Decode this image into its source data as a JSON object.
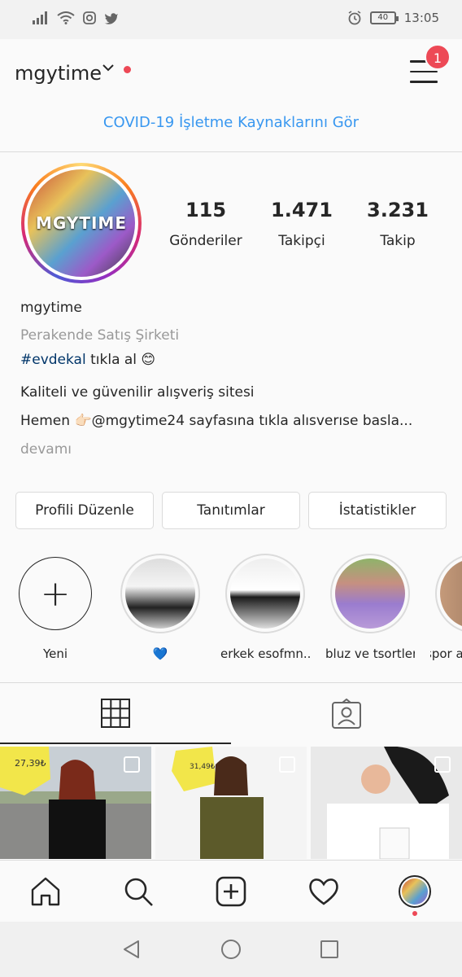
{
  "status_bar": {
    "time": "13:05",
    "battery": "40"
  },
  "header": {
    "username": "mgytime",
    "notification_count": "1"
  },
  "covid_link": "COVID-19 İşletme Kaynaklarını Gör",
  "profile": {
    "avatar_text": "MGYTIME",
    "stats": [
      {
        "value": "115",
        "label": "Gönderiler"
      },
      {
        "value": "1.471",
        "label": "Takipçi"
      },
      {
        "value": "3.231",
        "label": "Takip"
      }
    ],
    "name": "mgytime",
    "category": "Perakende Satış Şirketi",
    "bio_hashtag": "#evdekal",
    "bio_line1_rest": " tıkla al 😊",
    "bio_line2": "Kaliteli ve güvenilir alışveriş sitesi",
    "bio_line3": "Hemen 👉🏻@mgytime24 sayfasına tıkla alısverıse basla...",
    "more": "devamı"
  },
  "buttons": {
    "edit_profile": "Profili Düzenle",
    "promotions": "Tanıtımlar",
    "insights": "İstatistikler"
  },
  "highlights": [
    {
      "label": "Yeni"
    },
    {
      "label": "💙"
    },
    {
      "label": "erkek esofmn..."
    },
    {
      "label": "bluz ve tsortler"
    },
    {
      "label": "spor a"
    }
  ],
  "posts": [
    {
      "price_tag": "27,39₺"
    },
    {
      "price_tag": "31,49₺"
    },
    {
      "price_tag": ""
    }
  ],
  "colors": {
    "accent": "#3897f0",
    "notification": "#ed4956",
    "text": "#262626",
    "border": "#dbdbdb"
  }
}
